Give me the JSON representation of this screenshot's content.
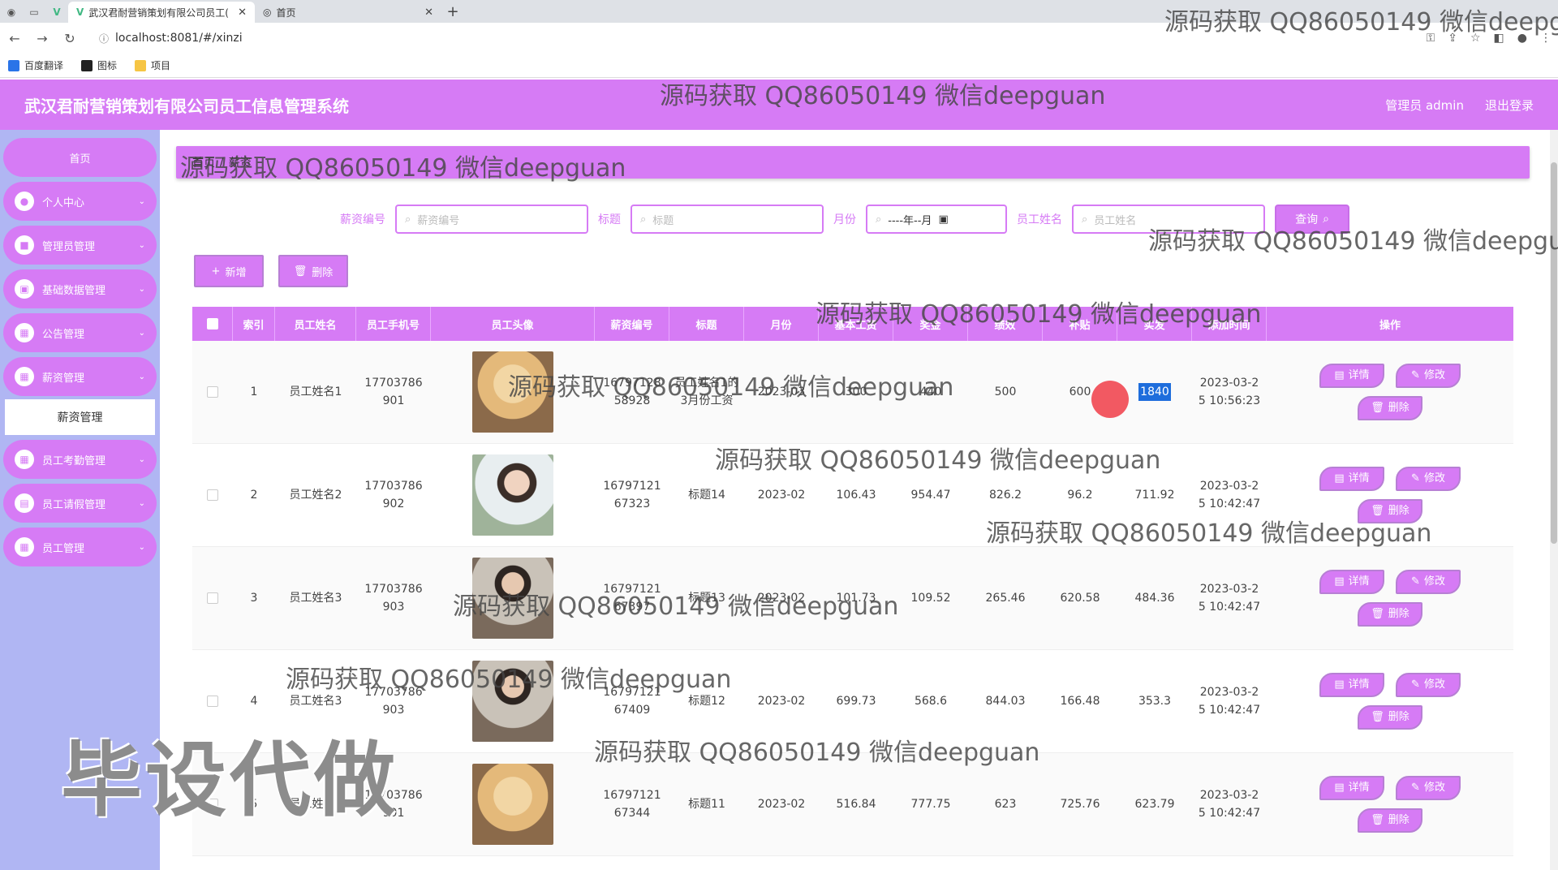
{
  "browser": {
    "tabs": [
      {
        "title": "武汉君耐营销策划有限公司员工(",
        "active": true
      },
      {
        "title": "首页",
        "active": false
      }
    ],
    "url": "localhost:8081/#/xinzi",
    "bookmarks": [
      "百度翻译",
      "图标",
      "项目"
    ]
  },
  "header": {
    "title": "武汉君耐营销策划有限公司员工信息管理系统",
    "user": "管理员 admin",
    "logout": "退出登录"
  },
  "sidebar": {
    "home": "首页",
    "items": [
      {
        "label": "个人中心"
      },
      {
        "label": "管理员管理"
      },
      {
        "label": "基础数据管理"
      },
      {
        "label": "公告管理"
      },
      {
        "label": "薪资管理"
      },
      {
        "label": "员工考勤管理"
      },
      {
        "label": "员工请假管理"
      },
      {
        "label": "员工管理"
      }
    ],
    "submenu": "薪资管理"
  },
  "breadcrumb": {
    "home": "首页",
    "sep": "/",
    "current": "薪资"
  },
  "search": {
    "fields": [
      {
        "label": "薪资编号",
        "placeholder": "薪资编号"
      },
      {
        "label": "标题",
        "placeholder": "标题"
      },
      {
        "label": "月份",
        "placeholder": "----年--月"
      },
      {
        "label": "员工姓名",
        "placeholder": "员工姓名"
      }
    ],
    "button": "查询"
  },
  "actions": {
    "add": "新增",
    "delete": "删除"
  },
  "table": {
    "headers": [
      "索引",
      "员工姓名",
      "员工手机号",
      "员工头像",
      "薪资编号",
      "标题",
      "月份",
      "基本工资",
      "奖金",
      "绩效",
      "补贴",
      "实发",
      "添加时间",
      "操作"
    ],
    "rows": [
      {
        "idx": "1",
        "name": "员工姓名1",
        "phone": "17703786901",
        "avatar": "dog",
        "no": "1679712858928",
        "title": "员工姓名1的3月份工资",
        "month": "2023-03",
        "base": "300",
        "bonus": "440",
        "perf": "500",
        "sub": "600",
        "net": "1840",
        "time": "2023-03-25 10:56:23"
      },
      {
        "idx": "2",
        "name": "员工姓名2",
        "phone": "17703786902",
        "avatar": "man2",
        "no": "1679712167323",
        "title": "标题14",
        "month": "2023-02",
        "base": "106.43",
        "bonus": "954.47",
        "perf": "826.2",
        "sub": "96.2",
        "net": "711.92",
        "time": "2023-03-25 10:42:47"
      },
      {
        "idx": "3",
        "name": "员工姓名3",
        "phone": "17703786903",
        "avatar": "man3",
        "no": "1679712167397",
        "title": "标题13",
        "month": "2023-02",
        "base": "101.73",
        "bonus": "109.52",
        "perf": "265.46",
        "sub": "620.58",
        "net": "484.36",
        "time": "2023-03-25 10:42:47"
      },
      {
        "idx": "4",
        "name": "员工姓名3",
        "phone": "17703786903",
        "avatar": "man3",
        "no": "1679712167409",
        "title": "标题12",
        "month": "2023-02",
        "base": "699.73",
        "bonus": "568.6",
        "perf": "844.03",
        "sub": "166.48",
        "net": "353.3",
        "time": "2023-03-25 10:42:47"
      },
      {
        "idx": "5",
        "name": "员工姓名1",
        "phone": "17703786901",
        "avatar": "dog",
        "no": "1679712167344",
        "title": "标题11",
        "month": "2023-02",
        "base": "516.84",
        "bonus": "777.75",
        "perf": "623",
        "sub": "725.76",
        "net": "623.79",
        "time": "2023-03-25 10:42:47"
      }
    ],
    "ops": {
      "detail": "详情",
      "edit": "修改",
      "delete": "删除"
    }
  },
  "watermark": {
    "text": "源码获取 QQ86050149 微信deepguan",
    "big": "毕设代做"
  },
  "colors": {
    "accent": "#d67bf5",
    "sidebar": "#b0b6f3"
  }
}
